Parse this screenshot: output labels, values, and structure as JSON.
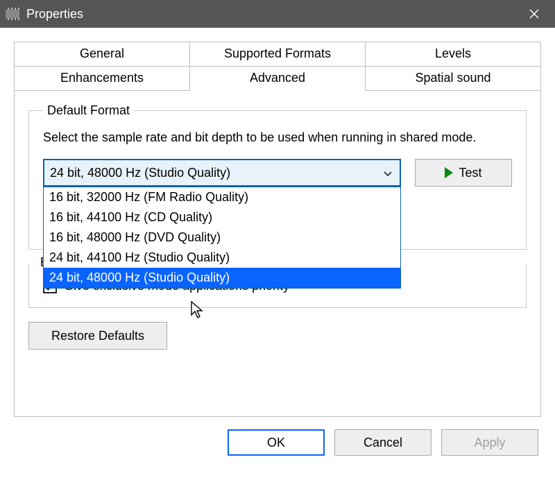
{
  "window": {
    "title": "Properties"
  },
  "tabs": {
    "row1": [
      "General",
      "Supported Formats",
      "Levels"
    ],
    "row2": [
      "Enhancements",
      "Advanced",
      "Spatial sound"
    ],
    "active": "Advanced"
  },
  "default_format": {
    "legend": "Default Format",
    "description": "Select the sample rate and bit depth to be used when running in shared mode.",
    "combo_selected": "24 bit, 48000 Hz (Studio Quality)",
    "options": [
      "16 bit, 32000 Hz (FM Radio Quality)",
      "16 bit, 44100 Hz (CD Quality)",
      "16 bit, 48000 Hz (DVD Quality)",
      "24 bit, 44100 Hz (Studio Quality)",
      "24 bit, 48000 Hz (Studio Quality)"
    ],
    "highlighted_index": 4,
    "test_label": "Test"
  },
  "exclusive_mode": {
    "visible_legend_fragment": "E",
    "give_priority_label": "Give exclusive mode applications priority",
    "give_priority_checked": true
  },
  "restore_defaults_label": "Restore Defaults",
  "buttons": {
    "ok": "OK",
    "cancel": "Cancel",
    "apply": "Apply"
  }
}
